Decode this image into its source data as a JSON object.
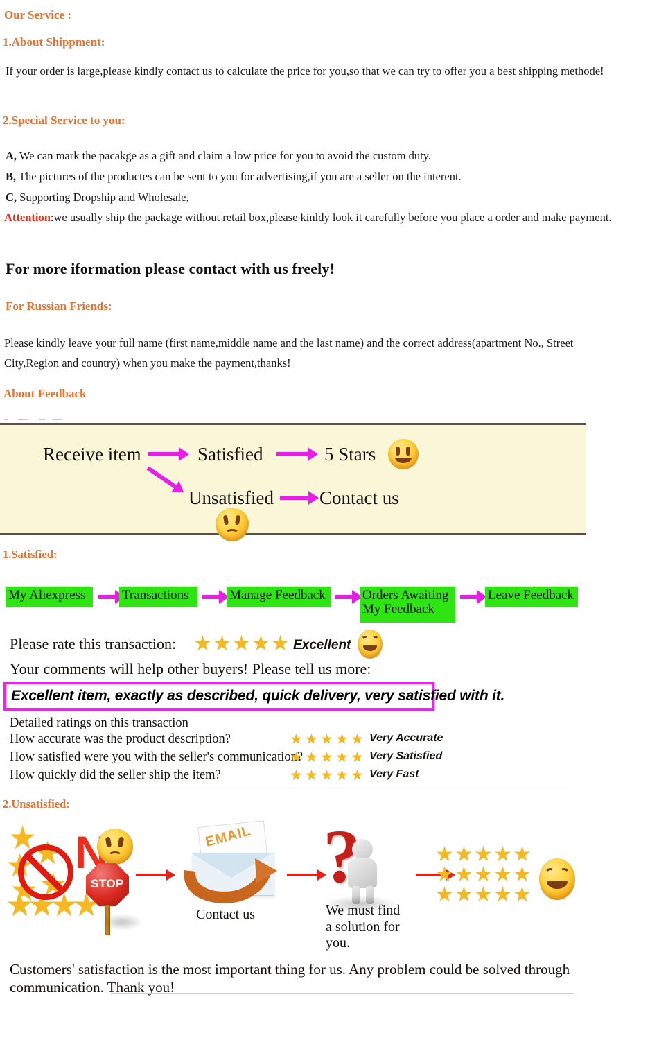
{
  "service": {
    "title": "Our Service :",
    "shipment_heading": "1.About Shippment:",
    "shipment_text": "If your order is large,please kindly contact us to calculate the price  for you,so that we can try to offer you a best shipping  methode!",
    "special_heading": "2.Special Service to you:",
    "items": [
      {
        "marker": "A,",
        "text": " We can mark the pacakge as a gift and claim a low price for  you to avoid the custom duty."
      },
      {
        "marker": "B,",
        "text": " The pictures of the productes can be sent to you for advertising,if you are a seller on the interent."
      },
      {
        "marker": "C,",
        "text": " Supporting Dropship and Wholesale,"
      }
    ],
    "attention_label": "Attention",
    "attention_text": ":we usually ship the package without retail box,please kinldy look it carefully before you place  a order and make payment.",
    "contact_heading": "For more iformation please contact with us freely!"
  },
  "russian": {
    "heading": "For Russian Friends:",
    "text": "Please kindly leave your full name (first name,middle name and the last  name) and the correct address(apartment No., Street City,Region and country) when you make the payment,thanks!"
  },
  "feedback": {
    "heading": "About Feedback",
    "flow": {
      "receive": "Receive item",
      "satisfied": "Satisfied",
      "five_stars": "5 Stars",
      "unsatisfied": "Unsatisfied",
      "contact_us": "Contact us"
    },
    "satisfied_heading": "1.Satisfied:",
    "steps": [
      "My Aliexpress",
      "Transactions",
      "Manage Feedback",
      "Orders Awaiting\nMy Feedback",
      "Leave Feedback"
    ],
    "rate_prompt": "Please rate this transaction:",
    "rate_value": "Excellent",
    "rate_stars": 5,
    "comments_prompt": "Your comments will help other buyers! Please tell us more:",
    "comment_text": "Excellent item, exactly as described, quick delivery, very satisfied with it.",
    "detailed_heading": "Detailed ratings on this transaction",
    "detailed_rows": [
      {
        "question": "How accurate was the product description?",
        "stars": 5,
        "label": "Very Accurate"
      },
      {
        "question": "How satisfied were you with the seller's communication?",
        "stars": 5,
        "label": "Very Satisfied"
      },
      {
        "question": "How quickly did the seller ship the item?",
        "stars": 5,
        "label": "Very Fast"
      }
    ],
    "unsatisfied_heading": "2.Unsatisfied:",
    "unsat_flow": {
      "no_label": "N",
      "stop_label": "STOP",
      "email_label": "EMAIL",
      "contact_caption": "Contact us",
      "solution_caption": "We must find\na solution for\nyou.",
      "final_star_rows": 3,
      "final_star_per_row": 5
    },
    "closing_text": "Customers' satisfaction is the most important thing for us. Any problem could be solved through communication. Thank you!"
  },
  "colors": {
    "heading_orange": "#e8722e",
    "attention_red": "#e8301c",
    "green_box": "#2ee413",
    "magenta_arrow": "#e61ee6",
    "red_arrow": "#e52118",
    "star_gold": "#f5b821",
    "cream_panel": "#faf7d8",
    "comment_border": "#f020f0"
  }
}
